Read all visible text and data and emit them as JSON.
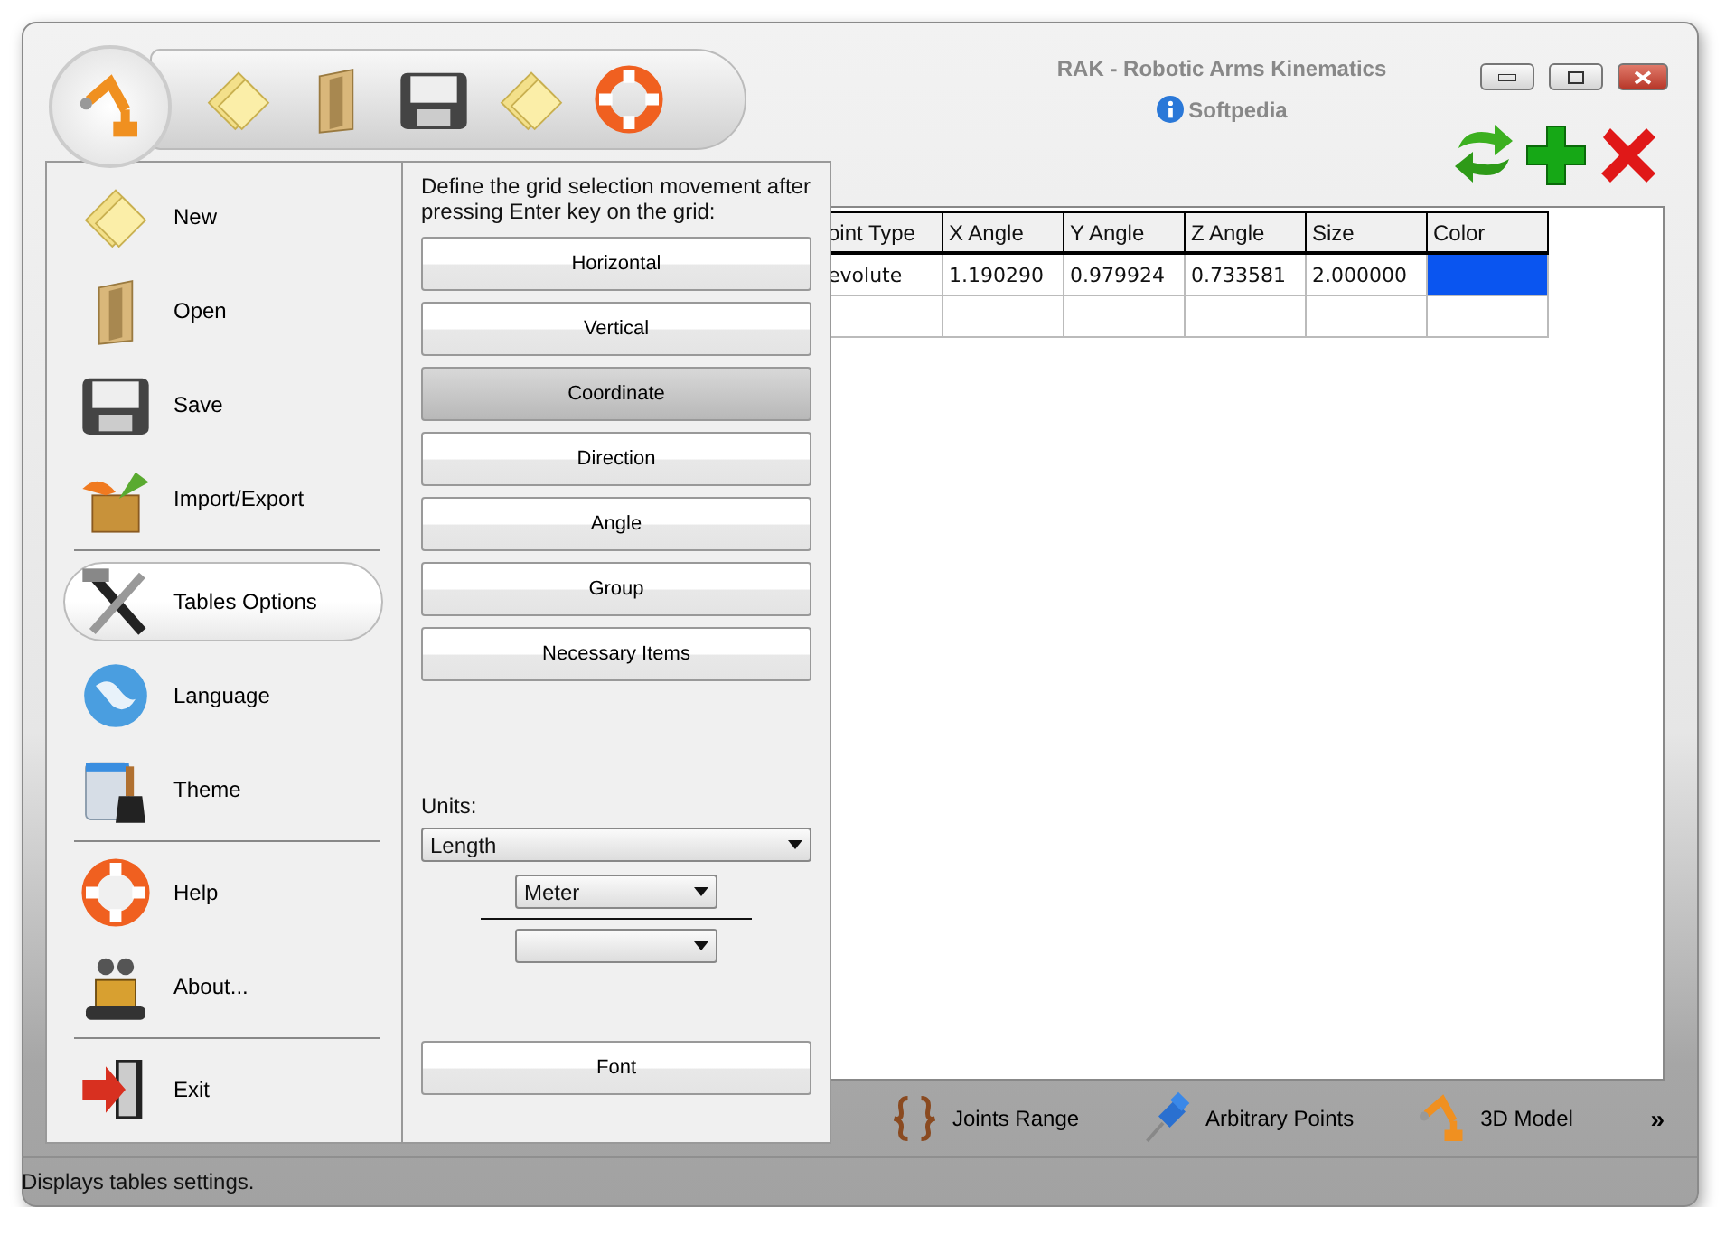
{
  "window": {
    "title": "RAK - Robotic Arms Kinematics",
    "subtitle": "Softpedia"
  },
  "app_menu": {
    "groups": [
      [
        {
          "label": "New",
          "kind": "new",
          "selected": false
        },
        {
          "label": "Open",
          "kind": "open",
          "selected": false
        },
        {
          "label": "Save",
          "kind": "save",
          "selected": false
        },
        {
          "label": "Import/Export",
          "kind": "import",
          "selected": false
        }
      ],
      [
        {
          "label": "Tables Options",
          "kind": "tools",
          "selected": true
        },
        {
          "label": "Language",
          "kind": "globe",
          "selected": false
        },
        {
          "label": "Theme",
          "kind": "paint",
          "selected": false
        }
      ],
      [
        {
          "label": "Help",
          "kind": "help",
          "selected": false
        },
        {
          "label": "About...",
          "kind": "robot",
          "selected": false
        }
      ],
      [
        {
          "label": "Exit",
          "kind": "exit",
          "selected": false
        }
      ]
    ]
  },
  "options_panel": {
    "instruction": "Define the grid selection movement after pressing Enter key on the grid:",
    "movement_buttons": [
      {
        "label": "Horizontal",
        "selected": false
      },
      {
        "label": "Vertical",
        "selected": false
      },
      {
        "label": "Coordinate",
        "selected": true
      },
      {
        "label": "Direction",
        "selected": false
      },
      {
        "label": "Angle",
        "selected": false
      },
      {
        "label": "Group",
        "selected": false
      },
      {
        "label": "Necessary Items",
        "selected": false
      }
    ],
    "units_label": "Units:",
    "unit_type": "Length",
    "numerator_unit": "Meter",
    "font_button": "Font"
  },
  "table": {
    "columns": [
      "oint Type",
      "X Angle",
      "Y Angle",
      "Z Angle",
      "Size",
      "Color"
    ],
    "rows": [
      {
        "cells": [
          "evolute",
          "1.190290",
          "0.979924",
          "0.733581",
          "2.000000"
        ],
        "color": "#0a55f0"
      }
    ]
  },
  "bottom_tabs": [
    {
      "label": "Joints Range",
      "kind": "braces"
    },
    {
      "label": "Arbitrary Points",
      "kind": "pin"
    },
    {
      "label": "3D Model",
      "kind": "robot_arm"
    }
  ],
  "more_button": "»",
  "status_bar": "Displays tables settings."
}
